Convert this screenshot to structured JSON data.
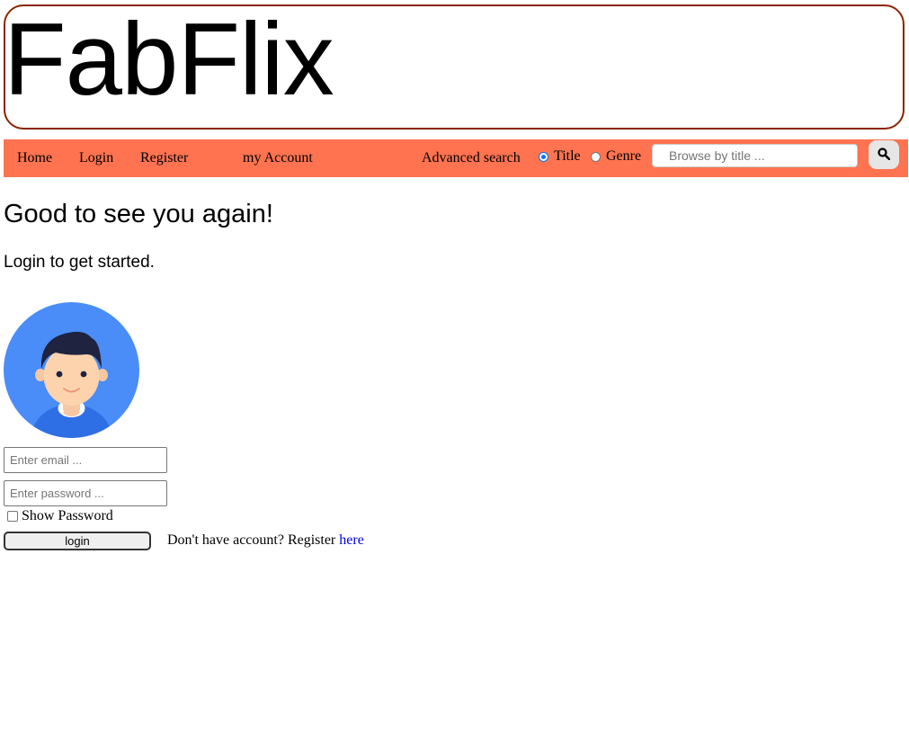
{
  "header": {
    "logo": "FabFlix"
  },
  "nav": {
    "links": [
      "Home",
      "Login",
      "Register",
      "my Account"
    ],
    "advanced_search": "Advanced search",
    "radio_title": "Title",
    "radio_genre": "Genre",
    "selected_radio": "Title",
    "search_placeholder": "Browse by title ...",
    "search_icon": "magnifier-icon"
  },
  "main": {
    "greeting": "Good to see you again!",
    "subtext": "Login to get started.",
    "email_placeholder": "Enter email ...",
    "password_placeholder": "Enter password ...",
    "show_password": "Show Password",
    "show_password_checked": false,
    "login_button": "login",
    "register_prompt": "Don't have account? Register",
    "register_link": "here"
  },
  "colors": {
    "nav_bg": "#ff7350",
    "logo_border": "#8b2500",
    "link": "#0000ee",
    "avatar_bg": "#4a8df8"
  }
}
